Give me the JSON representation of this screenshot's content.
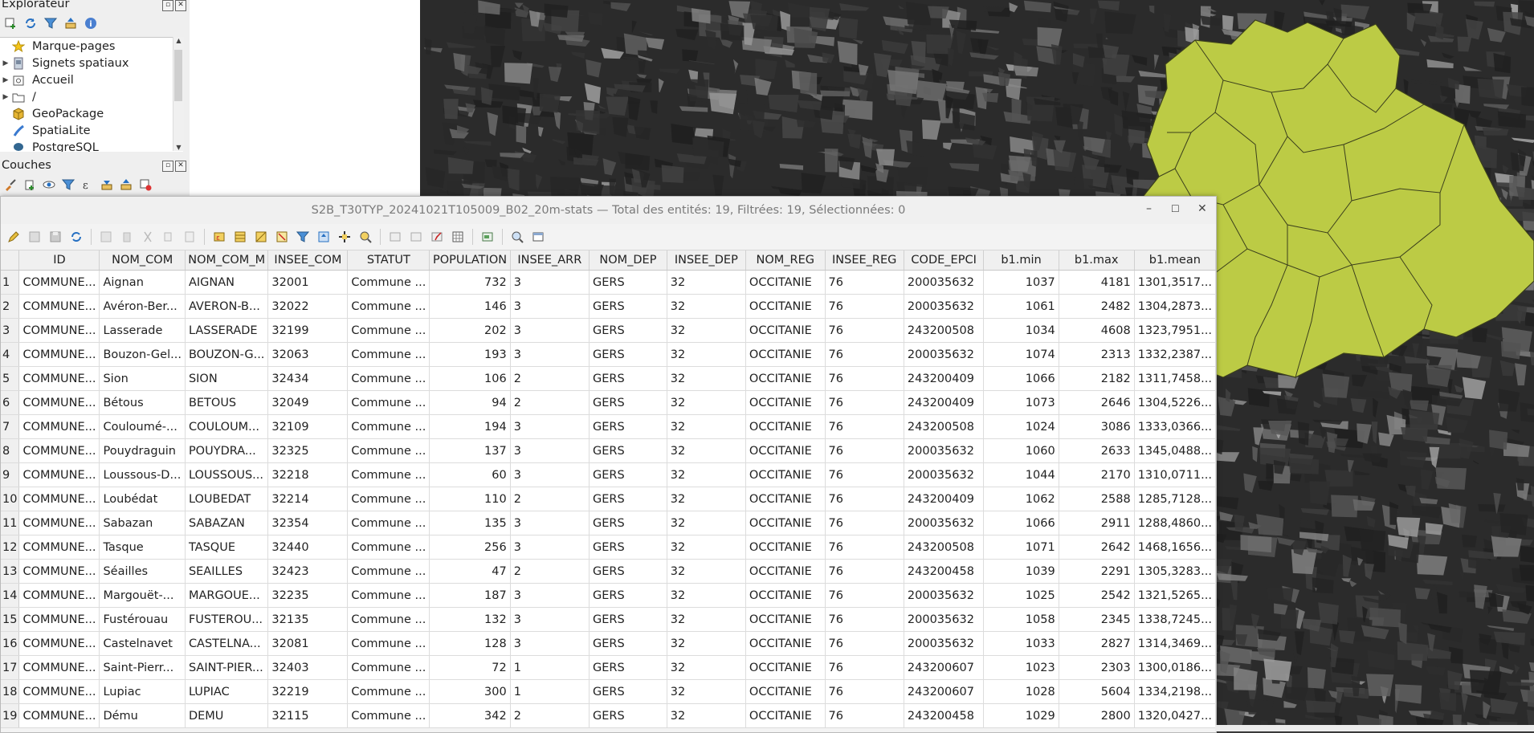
{
  "explorer": {
    "title": "Explorateur",
    "items": [
      {
        "label": "Marque-pages",
        "icon": "star-icon",
        "expandable": false
      },
      {
        "label": "Signets spatiaux",
        "icon": "spatial-bookmark-icon",
        "expandable": true
      },
      {
        "label": "Accueil",
        "icon": "home-folder-icon",
        "expandable": true
      },
      {
        "label": "/",
        "icon": "folder-icon",
        "expandable": true
      },
      {
        "label": "GeoPackage",
        "icon": "geopackage-icon",
        "expandable": false
      },
      {
        "label": "SpatiaLite",
        "icon": "spatialite-icon",
        "expandable": false
      },
      {
        "label": "PostgreSQL",
        "icon": "postgresql-icon",
        "expandable": false
      }
    ]
  },
  "layers": {
    "title": "Couches"
  },
  "attribute_table": {
    "title": "S2B_T30TYP_20241021T105009_B02_20m-stats — Total des entités: 19, Filtrées: 19, Sélectionnées: 0",
    "columns": [
      "ID",
      "NOM_COM",
      "NOM_COM_M",
      "INSEE_COM",
      "STATUT",
      "POPULATION",
      "INSEE_ARR",
      "NOM_DEP",
      "INSEE_DEP",
      "NOM_REG",
      "INSEE_REG",
      "CODE_EPCI",
      "b1.min",
      "b1.max",
      "b1.mean"
    ],
    "rows": [
      [
        "1",
        "COMMUNE...",
        "Aignan",
        "AIGNAN",
        "32001",
        "Commune ...",
        "732",
        "3",
        "GERS",
        "32",
        "OCCITANIE",
        "76",
        "200035632",
        "1037",
        "4181",
        "1301,3517..."
      ],
      [
        "2",
        "COMMUNE...",
        "Avéron-Ber...",
        "AVERON-B...",
        "32022",
        "Commune ...",
        "146",
        "3",
        "GERS",
        "32",
        "OCCITANIE",
        "76",
        "200035632",
        "1061",
        "2482",
        "1304,2873..."
      ],
      [
        "3",
        "COMMUNE...",
        "Lasserade",
        "LASSERADE",
        "32199",
        "Commune ...",
        "202",
        "3",
        "GERS",
        "32",
        "OCCITANIE",
        "76",
        "243200508",
        "1034",
        "4608",
        "1323,7951..."
      ],
      [
        "4",
        "COMMUNE...",
        "Bouzon-Gel...",
        "BOUZON-G...",
        "32063",
        "Commune ...",
        "193",
        "3",
        "GERS",
        "32",
        "OCCITANIE",
        "76",
        "200035632",
        "1074",
        "2313",
        "1332,2387..."
      ],
      [
        "5",
        "COMMUNE...",
        "Sion",
        "SION",
        "32434",
        "Commune ...",
        "106",
        "2",
        "GERS",
        "32",
        "OCCITANIE",
        "76",
        "243200409",
        "1066",
        "2182",
        "1311,7458..."
      ],
      [
        "6",
        "COMMUNE...",
        "Bétous",
        "BETOUS",
        "32049",
        "Commune ...",
        "94",
        "2",
        "GERS",
        "32",
        "OCCITANIE",
        "76",
        "243200409",
        "1073",
        "2646",
        "1304,5226..."
      ],
      [
        "7",
        "COMMUNE...",
        "Couloumé-...",
        "COULOUM...",
        "32109",
        "Commune ...",
        "194",
        "3",
        "GERS",
        "32",
        "OCCITANIE",
        "76",
        "243200508",
        "1024",
        "3086",
        "1333,0366..."
      ],
      [
        "8",
        "COMMUNE...",
        "Pouydraguin",
        "POUYDRA...",
        "32325",
        "Commune ...",
        "137",
        "3",
        "GERS",
        "32",
        "OCCITANIE",
        "76",
        "200035632",
        "1060",
        "2633",
        "1345,0488..."
      ],
      [
        "9",
        "COMMUNE...",
        "Loussous-D...",
        "LOUSSOUS...",
        "32218",
        "Commune ...",
        "60",
        "3",
        "GERS",
        "32",
        "OCCITANIE",
        "76",
        "200035632",
        "1044",
        "2170",
        "1310,0711..."
      ],
      [
        "10",
        "COMMUNE...",
        "Loubédat",
        "LOUBEDAT",
        "32214",
        "Commune ...",
        "110",
        "2",
        "GERS",
        "32",
        "OCCITANIE",
        "76",
        "243200409",
        "1062",
        "2588",
        "1285,7128..."
      ],
      [
        "11",
        "COMMUNE...",
        "Sabazan",
        "SABAZAN",
        "32354",
        "Commune ...",
        "135",
        "3",
        "GERS",
        "32",
        "OCCITANIE",
        "76",
        "200035632",
        "1066",
        "2911",
        "1288,4860..."
      ],
      [
        "12",
        "COMMUNE...",
        "Tasque",
        "TASQUE",
        "32440",
        "Commune ...",
        "256",
        "3",
        "GERS",
        "32",
        "OCCITANIE",
        "76",
        "243200508",
        "1071",
        "2642",
        "1468,1656..."
      ],
      [
        "13",
        "COMMUNE...",
        "Séailles",
        "SEAILLES",
        "32423",
        "Commune ...",
        "47",
        "2",
        "GERS",
        "32",
        "OCCITANIE",
        "76",
        "243200458",
        "1039",
        "2291",
        "1305,3283..."
      ],
      [
        "14",
        "COMMUNE...",
        "Margouët-...",
        "MARGOUE...",
        "32235",
        "Commune ...",
        "187",
        "3",
        "GERS",
        "32",
        "OCCITANIE",
        "76",
        "200035632",
        "1025",
        "2542",
        "1321,5265..."
      ],
      [
        "15",
        "COMMUNE...",
        "Fustérouau",
        "FUSTEROU...",
        "32135",
        "Commune ...",
        "132",
        "3",
        "GERS",
        "32",
        "OCCITANIE",
        "76",
        "200035632",
        "1058",
        "2345",
        "1338,7245..."
      ],
      [
        "16",
        "COMMUNE...",
        "Castelnavet",
        "CASTELNA...",
        "32081",
        "Commune ...",
        "128",
        "3",
        "GERS",
        "32",
        "OCCITANIE",
        "76",
        "200035632",
        "1033",
        "2827",
        "1314,3469..."
      ],
      [
        "17",
        "COMMUNE...",
        "Saint-Pierr...",
        "SAINT-PIER...",
        "32403",
        "Commune ...",
        "72",
        "1",
        "GERS",
        "32",
        "OCCITANIE",
        "76",
        "243200607",
        "1023",
        "2303",
        "1300,0186..."
      ],
      [
        "18",
        "COMMUNE...",
        "Lupiac",
        "LUPIAC",
        "32219",
        "Commune ...",
        "300",
        "1",
        "GERS",
        "32",
        "OCCITANIE",
        "76",
        "243200607",
        "1028",
        "5604",
        "1334,2198..."
      ],
      [
        "19",
        "COMMUNE...",
        "Dému",
        "DEMU",
        "32115",
        "Commune ...",
        "342",
        "2",
        "GERS",
        "32",
        "OCCITANIE",
        "76",
        "243200458",
        "1029",
        "2800",
        "1320,0427..."
      ]
    ]
  },
  "colors": {
    "polygon_fill": "#bccb45",
    "polygon_stroke": "#3b3f1c",
    "raster_bg": "#2b2b2b"
  }
}
